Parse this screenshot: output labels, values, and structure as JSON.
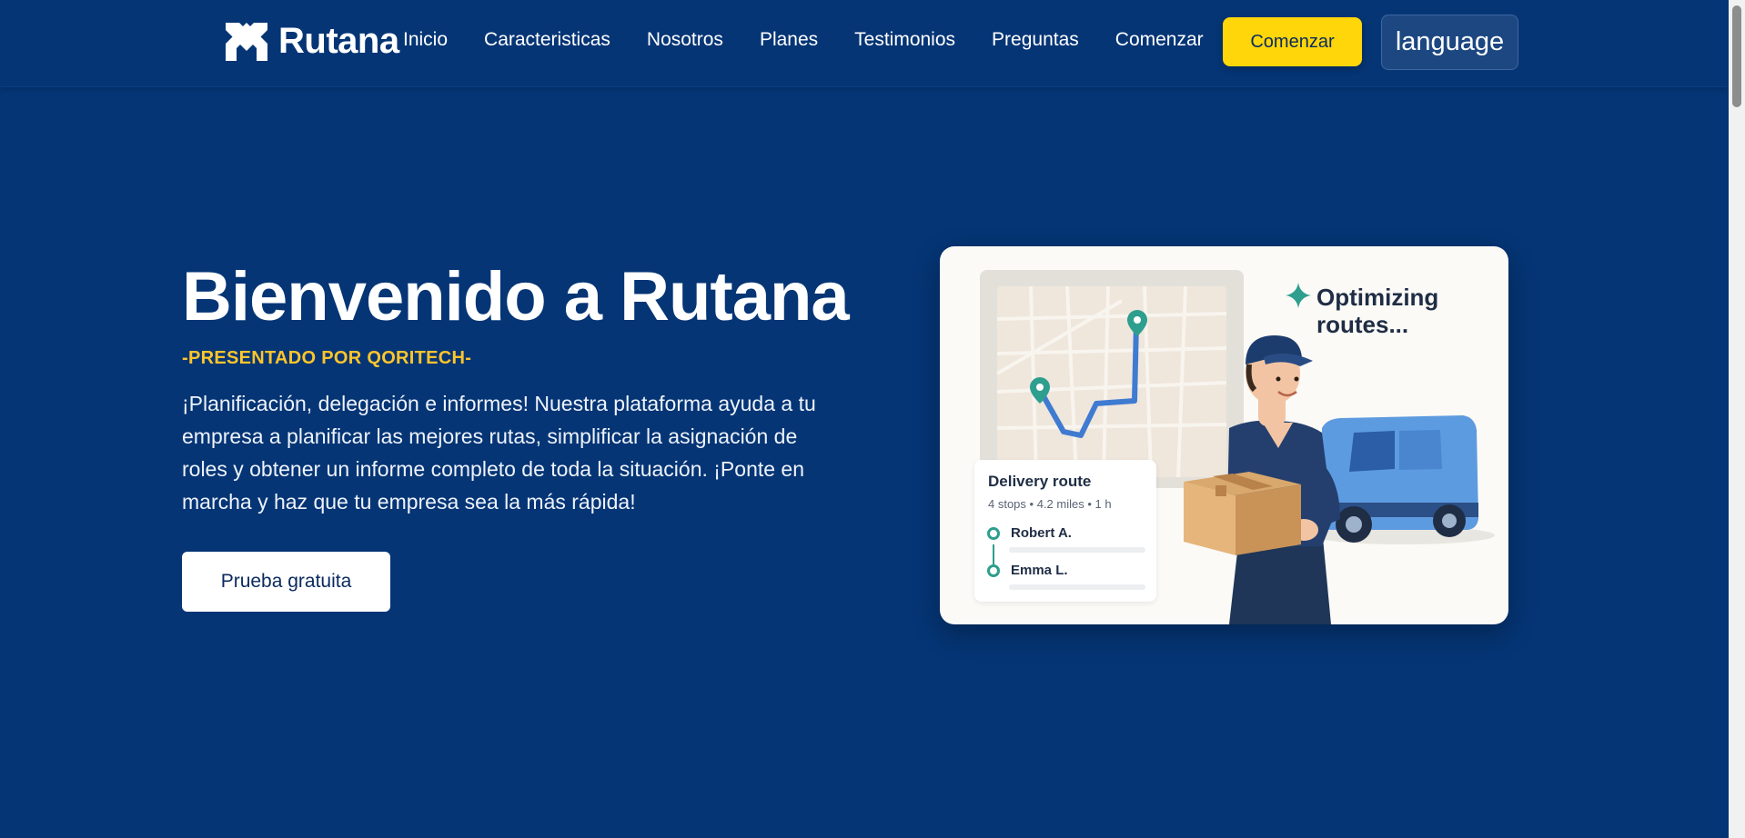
{
  "brand": {
    "name": "Rutana"
  },
  "nav": {
    "items": [
      {
        "label": "Inicio"
      },
      {
        "label": "Caracteristicas"
      },
      {
        "label": "Nosotros"
      },
      {
        "label": "Planes"
      },
      {
        "label": "Testimonios"
      },
      {
        "label": "Preguntas"
      },
      {
        "label": "Comenzar"
      }
    ],
    "cta_label": "Comenzar",
    "language_label": "language"
  },
  "hero": {
    "title": "Bienvenido a Rutana",
    "subtitle": "-PRESENTADO POR QORITECH-",
    "description": "¡Planificación, delegación e informes! Nuestra plataforma ayuda a tu empresa a planificar las mejores rutas, simplificar la asignación de roles y obtener un informe completo de toda la situación. ¡Ponte en marcha y haz que tu empresa sea la más rápida!",
    "button_label": "Prueba gratuita"
  },
  "illustration": {
    "status_text": "Optimizing routes...",
    "route_card": {
      "title": "Delivery route",
      "stops": "4 stops",
      "distance": "4.2 miles",
      "duration": "1 h",
      "people": [
        "Robert A.",
        "Emma L."
      ]
    }
  },
  "colors": {
    "background": "#053575",
    "accent": "#ffd60a",
    "subtitle": "#ffc52b",
    "card": "#fbfaf6",
    "route_line": "#3f7bd1",
    "pin": "#2e9e8e"
  },
  "icons": [
    "logo-mark-icon",
    "sparkle-icon",
    "map-pin-icon"
  ]
}
